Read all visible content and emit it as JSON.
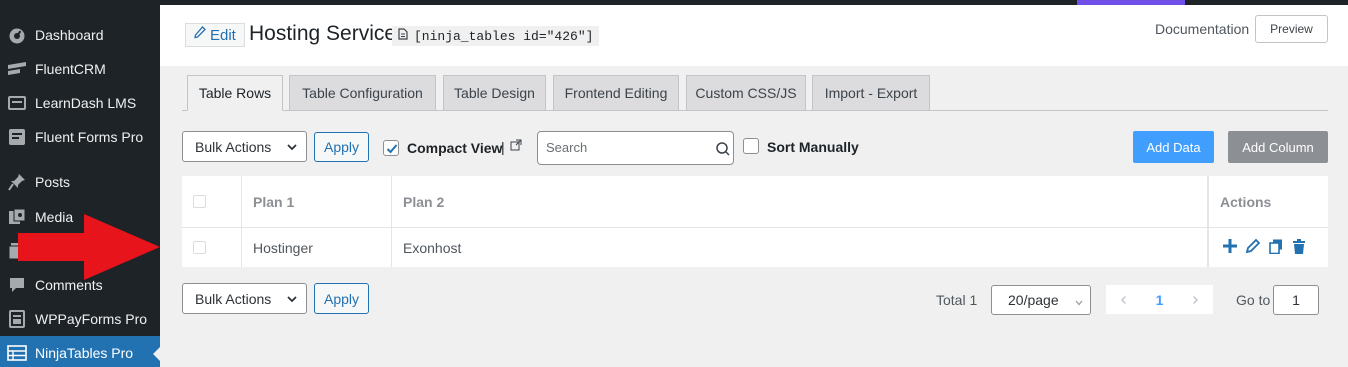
{
  "sidebar": {
    "items": [
      {
        "label": "Dashboard",
        "icon": "dashboard-icon"
      },
      {
        "label": "FluentCRM",
        "icon": "fluentcrm-icon"
      },
      {
        "label": "LearnDash LMS",
        "icon": "learndash-icon"
      },
      {
        "label": "Fluent Forms Pro",
        "icon": "fluentforms-icon"
      },
      {
        "label": "Posts",
        "icon": "pin-icon"
      },
      {
        "label": "Media",
        "icon": "media-icon"
      },
      {
        "label": "",
        "icon": "pages-icon"
      },
      {
        "label": "Comments",
        "icon": "comments-icon"
      },
      {
        "label": "WPPayForms Pro",
        "icon": "payforms-icon"
      },
      {
        "label": "NinjaTables Pro",
        "icon": "table-icon",
        "active": true
      }
    ]
  },
  "header": {
    "edit_label": "Edit",
    "title": "Hosting Service",
    "shortcode": "[ninja_tables id=\"426\"]",
    "documentation": "Documentation",
    "preview": "Preview"
  },
  "tabs": [
    {
      "label": "Table Rows",
      "active": true
    },
    {
      "label": "Table Configuration"
    },
    {
      "label": "Table Design"
    },
    {
      "label": "Frontend Editing"
    },
    {
      "label": "Custom CSS/JS"
    },
    {
      "label": "Import - Export"
    }
  ],
  "toolbar": {
    "bulk_actions": "Bulk Actions",
    "apply": "Apply",
    "compact_view": "Compact View",
    "compact_sep": "|",
    "search_placeholder": "Search",
    "sort_manually": "Sort Manually",
    "add_data": "Add Data",
    "add_column": "Add Column"
  },
  "table": {
    "columns": [
      "Plan 1",
      "Plan 2",
      "Actions"
    ],
    "rows": [
      [
        "Hostinger",
        "Exonhost"
      ]
    ]
  },
  "footer": {
    "bulk_actions": "Bulk Actions",
    "apply": "Apply",
    "total": "Total 1",
    "per_page": "20/page",
    "current_page": "1",
    "goto_label": "Go to",
    "goto_value": "1"
  },
  "colors": {
    "sidebar_bg": "#1d2327",
    "active_menu": "#2271b1",
    "add_data": "#409eff",
    "add_column": "#8c8f94",
    "arrow": "#e8141b",
    "accent_purple": "#6f4fe8"
  }
}
